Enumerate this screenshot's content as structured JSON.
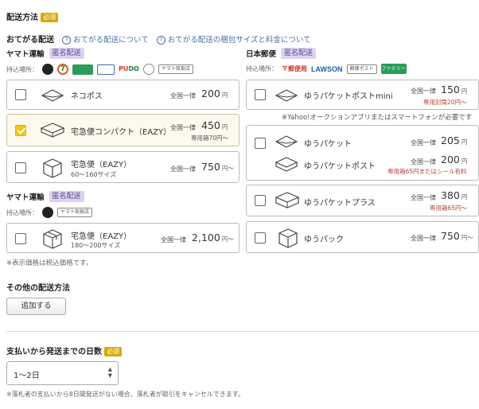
{
  "header": {
    "title": "配送方法",
    "required": "必須"
  },
  "otegaru": {
    "title": "おてがる配送",
    "link1": "おてがる配送について",
    "link2": "おてがる配送の梱包サイズと料金について"
  },
  "yamato": {
    "label": "ヤマト運輸",
    "anon": "匿名配送",
    "stores_label": "持込場所：",
    "stores": [
      "ヤマト運輸",
      "セブン-イレブン",
      "ファミリーマート",
      "PUDO",
      "Smari",
      "ヤマト取扱店"
    ]
  },
  "yamato_items": [
    {
      "name": "ネコポス",
      "flat": "全国一律",
      "price": "200",
      "unit": "円",
      "sub": "",
      "note": "",
      "checked": false
    },
    {
      "name": "宅急便コンパクト（EAZY）",
      "flat": "全国一律",
      "price": "450",
      "unit": "円",
      "sub": "",
      "note": "専用箱70円～",
      "checked": true
    },
    {
      "name": "宅急便（EAZY）",
      "flat": "全国一律",
      "price": "750",
      "unit": "円～",
      "sub": "60～160サイズ",
      "note": "",
      "checked": false
    }
  ],
  "yamato2": {
    "label": "ヤマト運輸",
    "anon": "匿名配送",
    "stores_label": "持込場所：",
    "stores": [
      "ヤマト運輸",
      "ヤマト取扱店"
    ]
  },
  "yamato2_items": [
    {
      "name": "宅急便（EAZY）",
      "flat": "全国一律",
      "price": "2,100",
      "unit": "円～",
      "sub": "180～200サイズ",
      "checked": false
    }
  ],
  "tax_note": "※表示価格は税込価格です。",
  "japanpost": {
    "label": "日本郵便",
    "anon": "匿名配送",
    "stores_label": "持込場所：",
    "stores": [
      "郵便局",
      "LAWSON",
      "郵便ポスト",
      "ファミリーマート"
    ]
  },
  "jp_items": [
    {
      "name": "ゆうパケットポストmini",
      "flat": "全国一律",
      "price": "150",
      "unit": "円",
      "note": "専用封筒20円～",
      "checked": false
    },
    {
      "name": "ゆうパケット",
      "flat": "全国一律",
      "price": "205",
      "unit": "円",
      "name2": "ゆうパケットポスト",
      "flat2": "全国一律",
      "price2": "200",
      "unit2": "円",
      "note2": "専用箱65円またはシール有料",
      "checked": false
    },
    {
      "name": "ゆうパケットプラス",
      "flat": "全国一律",
      "price": "380",
      "unit": "円",
      "note": "専用箱65円～",
      "checked": false
    },
    {
      "name": "ゆうパック",
      "flat": "全国一律",
      "price": "750",
      "unit": "円～",
      "checked": false
    }
  ],
  "yahoo_note": "※Yahoo!オークションアプリまたはスマートフォンが必要です",
  "other": {
    "title": "その他の配送方法",
    "add_button": "追加する"
  },
  "days": {
    "title": "支払いから発送までの日数",
    "required": "必須",
    "selected": "1～2日"
  },
  "cancel_note": "※落札者の支払いから8日間発送がない場合、落札者が取引をキャンセルできます。",
  "colors": {
    "accent": "#d9a800",
    "anon_bg": "#dcd3f0",
    "link": "#4a6fa5",
    "check": "#f5c518",
    "note_red": "#b7463c"
  }
}
